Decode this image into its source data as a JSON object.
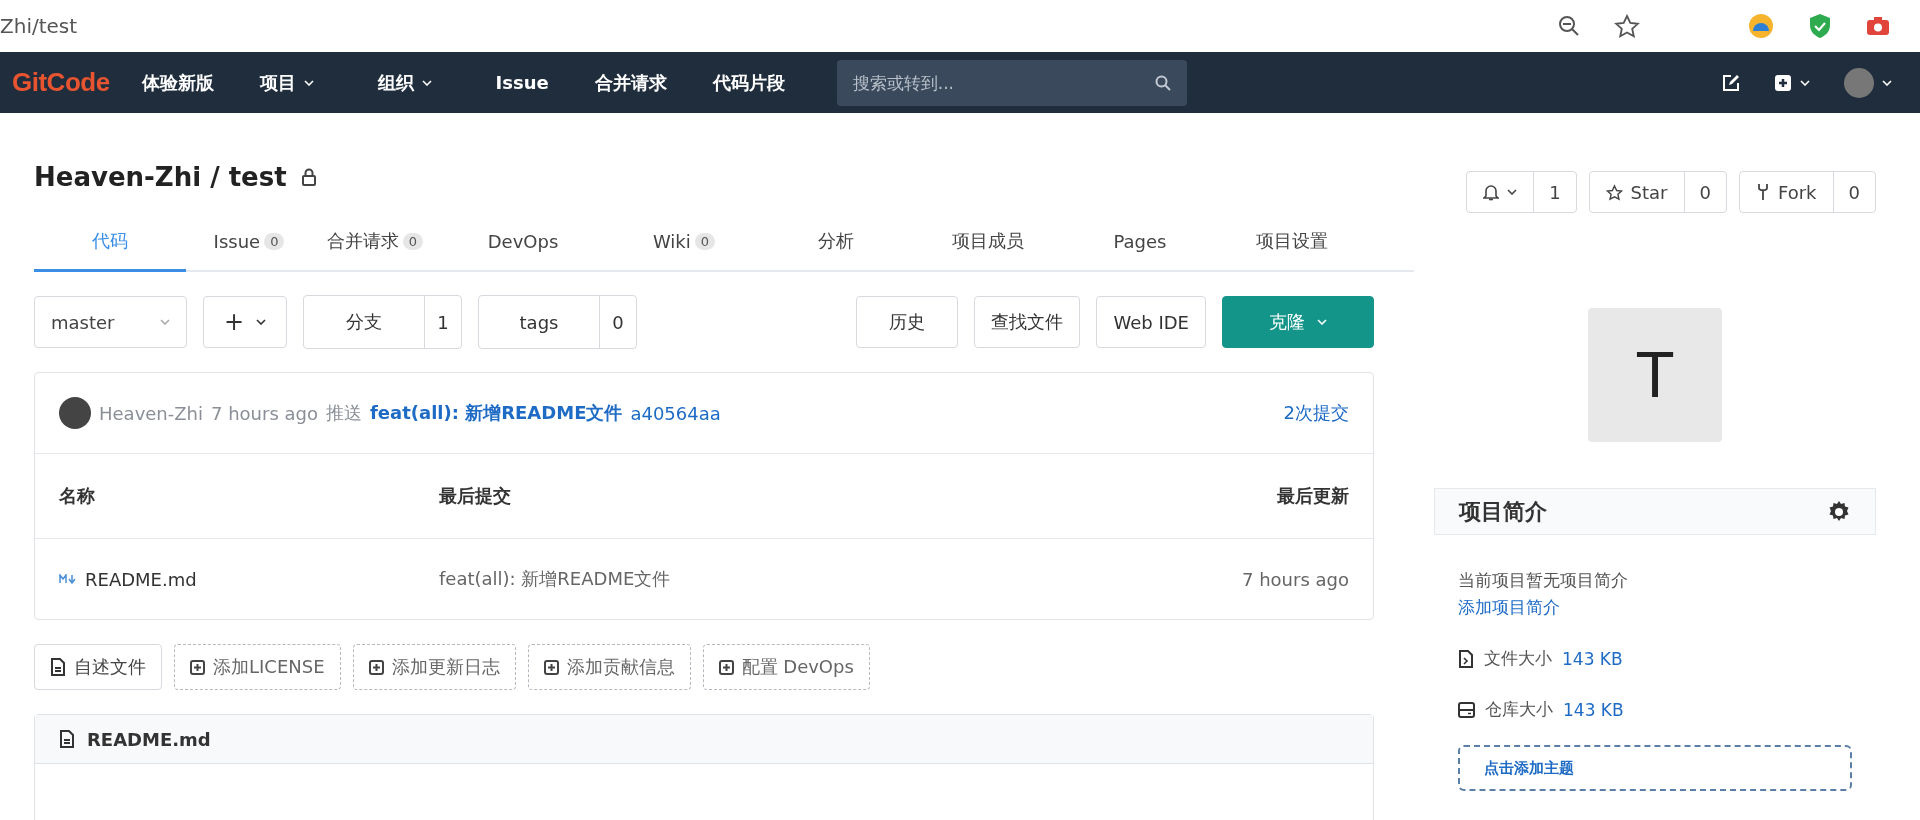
{
  "browser": {
    "url": "Zhi/test"
  },
  "nav": {
    "logo": "GitCode",
    "items": [
      {
        "label": "体验新版",
        "dropdown": false
      },
      {
        "label": "项目",
        "dropdown": true
      },
      {
        "label": "组织",
        "dropdown": true
      },
      {
        "label": "Issue",
        "dropdown": false
      },
      {
        "label": "合并请求",
        "dropdown": false
      },
      {
        "label": "代码片段",
        "dropdown": false
      }
    ],
    "search": {
      "placeholder": "搜索或转到..."
    }
  },
  "repo": {
    "title": "Heaven-Zhi / test",
    "watch": {
      "count": "1"
    },
    "star": {
      "label": "Star",
      "count": "0"
    },
    "fork": {
      "label": "Fork",
      "count": "0"
    }
  },
  "tabs": [
    {
      "label": "代码",
      "selected": true
    },
    {
      "label": "Issue",
      "count": "0",
      "selected": false
    },
    {
      "label": "合并请求",
      "count": "0",
      "selected": false
    },
    {
      "label": "DevOps",
      "selected": false
    },
    {
      "label": "Wiki",
      "count": "0",
      "selected": false
    },
    {
      "label": "分析",
      "selected": false
    },
    {
      "label": "项目成员",
      "selected": false
    },
    {
      "label": "Pages",
      "selected": false
    },
    {
      "label": "项目设置",
      "selected": false
    }
  ],
  "toolbar": {
    "branch": "master",
    "add": "+",
    "branches": {
      "label": "分支",
      "count": "1"
    },
    "tags": {
      "label": "tags",
      "count": "0"
    },
    "buttons": [
      "历史",
      "查找文件",
      "Web IDE"
    ],
    "clone": "克隆"
  },
  "commit": {
    "author": "Heaven-Zhi",
    "time": "7 hours ago",
    "action": "推送",
    "message": "feat(all): 新增README文件",
    "sha": "a40564aa",
    "count": "2次提交"
  },
  "files": {
    "columns": [
      "名称",
      "最后提交",
      "最后更新"
    ],
    "rows": [
      {
        "name": "README.md",
        "commit": "feat(all): 新增README文件",
        "updated": "7 hours ago"
      }
    ]
  },
  "quick_buttons": [
    {
      "label": "自述文件",
      "kind": "existing"
    },
    {
      "label": "添加LICENSE",
      "kind": "add"
    },
    {
      "label": "添加更新日志",
      "kind": "add"
    },
    {
      "label": "添加贡献信息",
      "kind": "add"
    },
    {
      "label": "配置 DevOps",
      "kind": "add"
    }
  ],
  "readme": {
    "title": "README.md"
  },
  "sidebar": {
    "avatar": "T",
    "about_title": "项目简介",
    "about_empty": "当前项目暂无项目简介",
    "about_add": "添加项目简介",
    "stats": [
      {
        "kind": "file",
        "label": "文件大小",
        "value": "143 KB"
      },
      {
        "kind": "repo",
        "label": "仓库大小",
        "value": "143 KB"
      }
    ],
    "topic": "点击添加主题"
  }
}
